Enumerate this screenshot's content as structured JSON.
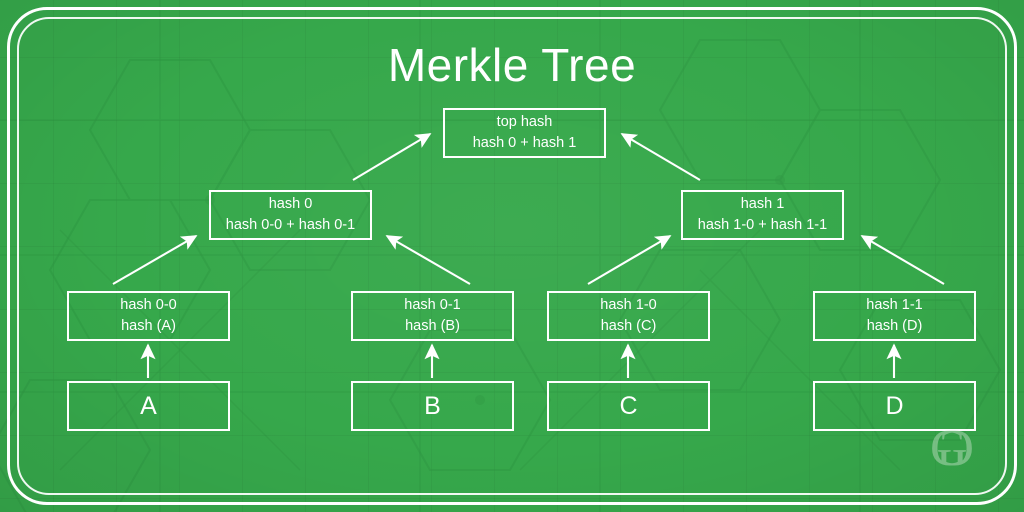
{
  "diagram": {
    "title": "Merkle Tree",
    "type": "merkle-tree",
    "colors": {
      "background_green": "#36a84b",
      "box_border": "#ffffff",
      "text": "#ffffff",
      "watermark": "#9ed0a6"
    },
    "levels": [
      {
        "level": 0,
        "name": "root",
        "nodes": [
          {
            "id": "top-hash",
            "line1": "top hash",
            "line2": "hash 0 + hash 1"
          }
        ]
      },
      {
        "level": 1,
        "name": "internal",
        "nodes": [
          {
            "id": "hash-0",
            "line1": "hash 0",
            "line2": "hash 0-0 + hash 0-1"
          },
          {
            "id": "hash-1",
            "line1": "hash 1",
            "line2": "hash 1-0 + hash 1-1"
          }
        ]
      },
      {
        "level": 2,
        "name": "leaf-hashes",
        "nodes": [
          {
            "id": "hash-0-0",
            "line1": "hash 0-0",
            "line2": "hash (A)"
          },
          {
            "id": "hash-0-1",
            "line1": "hash 0-1",
            "line2": "hash (B)"
          },
          {
            "id": "hash-1-0",
            "line1": "hash 1-0",
            "line2": "hash (C)"
          },
          {
            "id": "hash-1-1",
            "line1": "hash 1-1",
            "line2": "hash (D)"
          }
        ]
      },
      {
        "level": 3,
        "name": "data-blocks",
        "nodes": [
          {
            "id": "block-a",
            "label": "A"
          },
          {
            "id": "block-b",
            "label": "B"
          },
          {
            "id": "block-c",
            "label": "C"
          },
          {
            "id": "block-d",
            "label": "D"
          }
        ]
      }
    ],
    "edges": [
      {
        "from": "hash-0",
        "to": "top-hash"
      },
      {
        "from": "hash-1",
        "to": "top-hash"
      },
      {
        "from": "hash-0-0",
        "to": "hash-0"
      },
      {
        "from": "hash-0-1",
        "to": "hash-0"
      },
      {
        "from": "hash-1-0",
        "to": "hash-1"
      },
      {
        "from": "hash-1-1",
        "to": "hash-1"
      },
      {
        "from": "block-a",
        "to": "hash-0-0"
      },
      {
        "from": "block-b",
        "to": "hash-0-1"
      },
      {
        "from": "block-c",
        "to": "hash-1-0"
      },
      {
        "from": "block-d",
        "to": "hash-1-1"
      }
    ]
  },
  "watermark": {
    "name": "geeksforgeeks-logo",
    "text": "ƎG"
  }
}
